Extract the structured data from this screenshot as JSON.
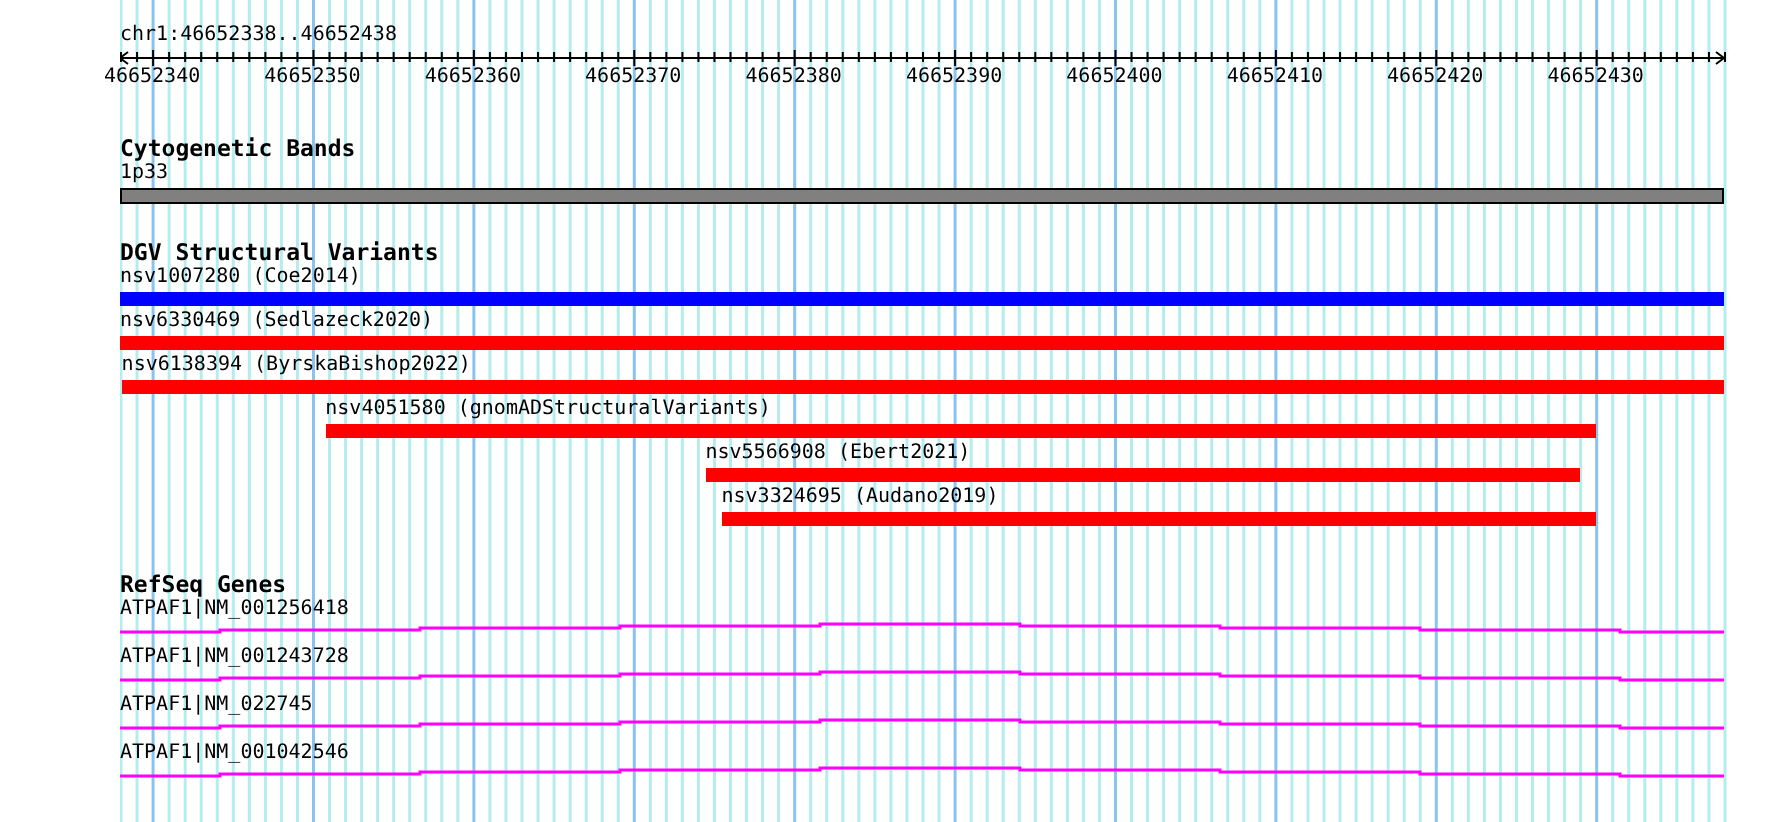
{
  "location": "chr1:46652338..46652438",
  "ruler": {
    "ticks": [
      "46652340",
      "46652350",
      "46652360",
      "46652370",
      "46652380",
      "46652390",
      "46652400",
      "46652410",
      "46652420",
      "46652430"
    ]
  },
  "tracks": [
    {
      "kind": "bands",
      "title": "Cytogenetic Bands",
      "features": [
        {
          "label": "1p33"
        }
      ]
    },
    {
      "kind": "variants",
      "title": "DGV Structural Variants",
      "features": [
        {
          "label": "nsv1007280 (Coe2014)",
          "color": "#0000ff"
        },
        {
          "label": "nsv6330469 (Sedlazeck2020)",
          "color": "#ff0000"
        },
        {
          "label": "nsv6138394 (ByrskaBishop2022)",
          "color": "#ff0000"
        },
        {
          "label": "nsv4051580 (gnomADStructuralVariants)",
          "color": "#ff0000"
        },
        {
          "label": "nsv5566908 (Ebert2021)",
          "color": "#ff0000"
        },
        {
          "label": "nsv3324695 (Audano2019)",
          "color": "#ff0000"
        }
      ]
    },
    {
      "kind": "genes",
      "title": "RefSeq Genes",
      "features": [
        {
          "label": "ATPAF1|NM_001256418"
        },
        {
          "label": "ATPAF1|NM_001243728"
        },
        {
          "label": "ATPAF1|NM_022745"
        },
        {
          "label": "ATPAF1|NM_001042546"
        }
      ]
    }
  ]
}
